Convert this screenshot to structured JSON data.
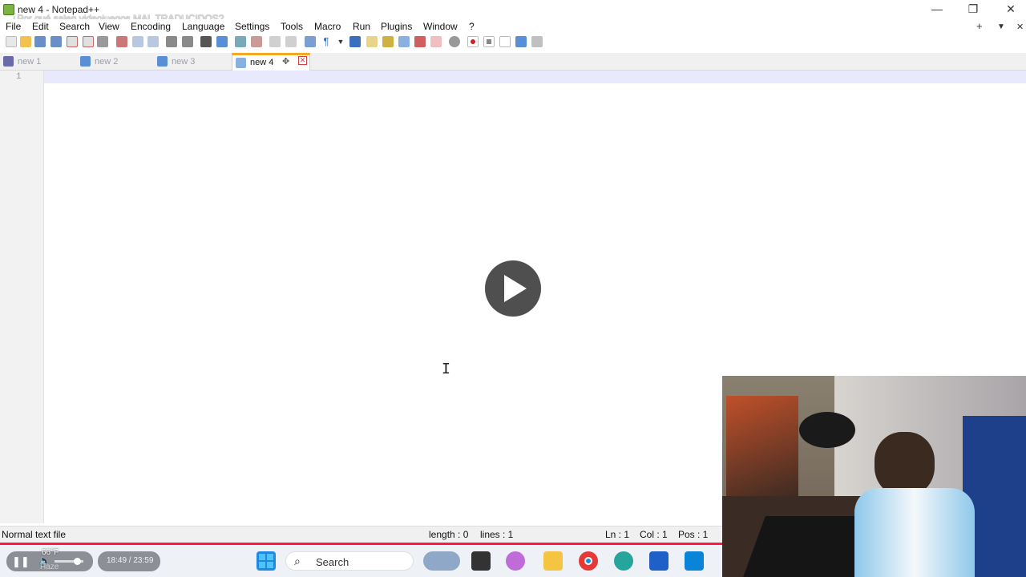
{
  "window": {
    "title": "new 4 - Notepad++",
    "video_overlay_title": "¿Por qué salen videojuegos MAL TRADUCIDOS?",
    "controls": {
      "minimize": "—",
      "restore": "❐",
      "close": "✕"
    }
  },
  "menu": {
    "items": [
      "File",
      "Edit",
      "Search",
      "View",
      "Encoding",
      "Language",
      "Settings",
      "Tools",
      "Macro",
      "Run",
      "Plugins",
      "Window",
      "?"
    ],
    "right": {
      "add": "+",
      "list": "▼",
      "close": "✕"
    }
  },
  "tabs": [
    {
      "label": "new 1",
      "active": false
    },
    {
      "label": "new 2",
      "active": false
    },
    {
      "label": "new 3",
      "active": false
    },
    {
      "label": "new 4",
      "active": true
    }
  ],
  "editor": {
    "line_number": "1",
    "cursor_glyph": "I"
  },
  "status": {
    "file_type": "Normal text file",
    "length": "length : 0",
    "lines": "lines : 1",
    "ln": "Ln : 1",
    "col": "Col : 1",
    "pos": "Pos : 1"
  },
  "player": {
    "weather_temp": "66°F",
    "weather_desc": "Haze",
    "time": "18:49 / 23:59",
    "progress_fraction": 0.79
  },
  "taskbar": {
    "search_label": "Search",
    "apps": [
      "start-icon",
      "widgets-icon",
      "file-explorer-icon",
      "copilot-icon",
      "folder-icon",
      "chrome-icon",
      "edge-icon",
      "store-icon",
      "outlook-icon"
    ]
  },
  "colors": {
    "accent_tab": "#f5a623",
    "progress": "#ff1744",
    "current_line": "#e8e8ff"
  }
}
